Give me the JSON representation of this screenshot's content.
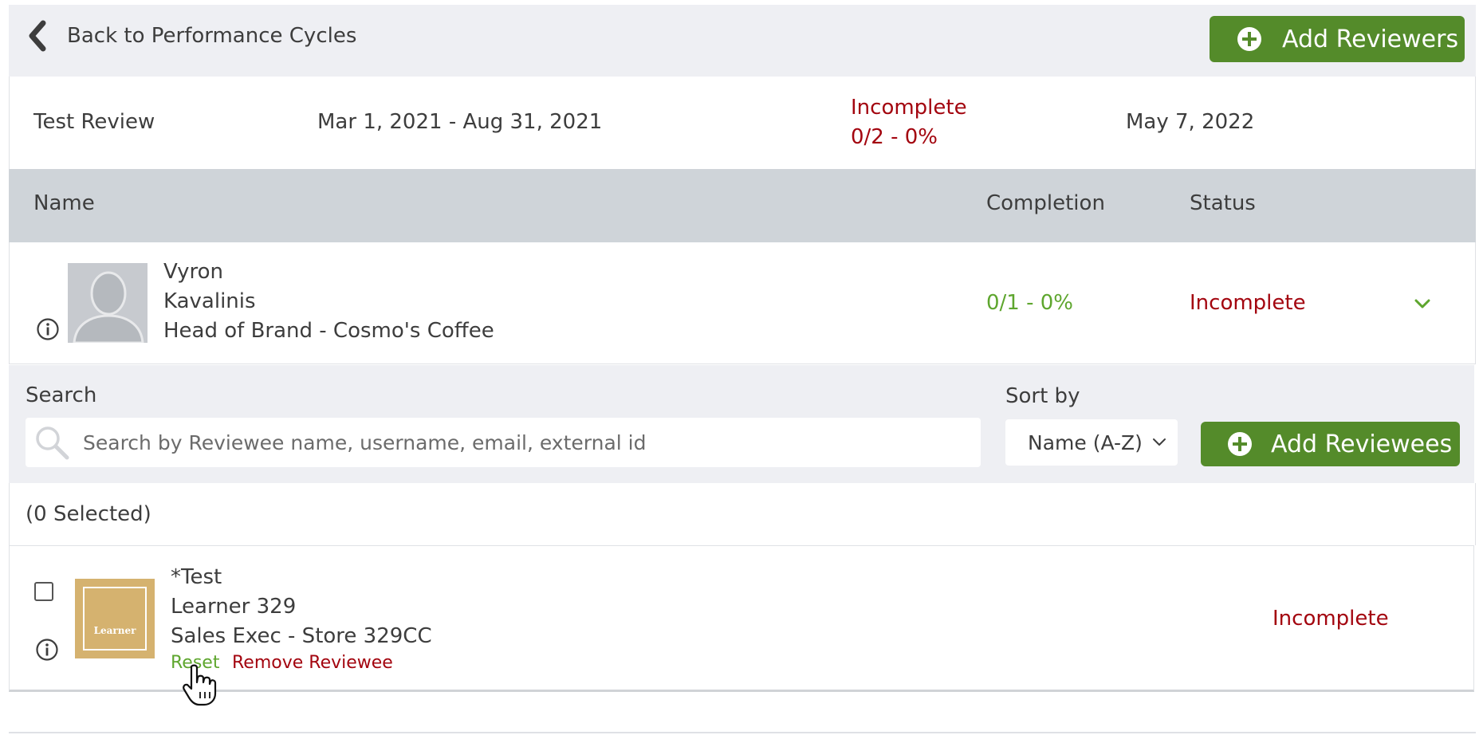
{
  "header": {
    "back_label": "Back to Performance Cycles",
    "add_reviewers_label": "Add Reviewers"
  },
  "cycle": {
    "name": "Test Review",
    "date_range": "Mar 1, 2021 - Aug 31, 2021",
    "status": "Incomplete",
    "progress": "0/2 - 0%",
    "due_date": "May 7, 2022"
  },
  "table": {
    "columns": [
      "Name",
      "Completion",
      "Status"
    ]
  },
  "reviewer": {
    "first_name": "Vyron",
    "last_name": "Kavalinis",
    "title": "Head of Brand - Cosmo's Coffee",
    "completion": "0/1 - 0%",
    "status": "Incomplete"
  },
  "search": {
    "label": "Search",
    "placeholder": "Search by Reviewee name, username, email, external id"
  },
  "sort": {
    "label": "Sort by",
    "selected": "Name (A-Z)"
  },
  "add_reviewees_label": "Add Reviewees",
  "selected_count": "(0 Selected)",
  "reviewee": {
    "first_name": "*Test",
    "last_name": "Learner 329",
    "title": "Sales Exec - Store 329CC",
    "reset_label": "Reset",
    "remove_label": "Remove Reviewee",
    "status": "Incomplete",
    "avatar_text": "Learner"
  },
  "colors": {
    "accent_green": "#548b2a",
    "status_red": "#a3050f",
    "progress_green": "#5ea62e"
  },
  "icons": [
    "chevron-left-icon",
    "plus-circle-icon",
    "info-icon",
    "chevron-down-icon",
    "search-icon",
    "hand-pointer-cursor-icon"
  ]
}
